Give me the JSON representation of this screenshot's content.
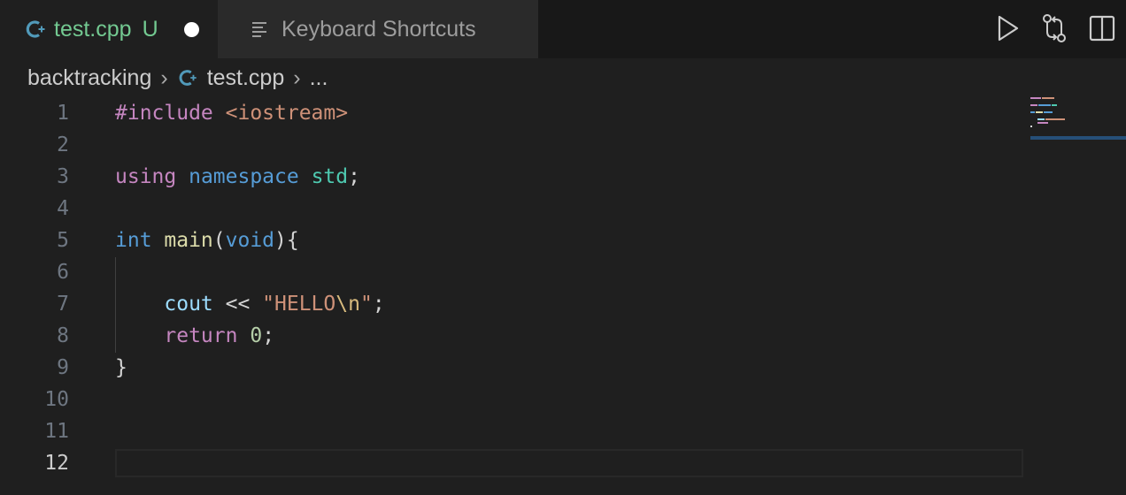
{
  "tabs": [
    {
      "label": "test.cpp",
      "status": "U",
      "icon": "cpp-icon",
      "modified": true,
      "active": true
    },
    {
      "label": "Keyboard Shortcuts",
      "icon": "list-icon",
      "active": false
    }
  ],
  "actions": [
    {
      "name": "run-button",
      "icon": "play-icon"
    },
    {
      "name": "compare-changes-button",
      "icon": "git-compare-icon"
    },
    {
      "name": "split-editor-button",
      "icon": "split-editor-icon"
    }
  ],
  "breadcrumb": {
    "folder": "backtracking",
    "file": "test.cpp",
    "more": "..."
  },
  "editor": {
    "current_line": 12,
    "lines": [
      {
        "num": "1",
        "tokens": [
          [
            "pre",
            "#include "
          ],
          [
            "inc",
            "<iostream>"
          ]
        ]
      },
      {
        "num": "2",
        "tokens": []
      },
      {
        "num": "3",
        "tokens": [
          [
            "kw",
            "using "
          ],
          [
            "type",
            "namespace "
          ],
          [
            "ns",
            "std"
          ],
          [
            "punc",
            ";"
          ]
        ]
      },
      {
        "num": "4",
        "tokens": []
      },
      {
        "num": "5",
        "tokens": [
          [
            "type",
            "int "
          ],
          [
            "fn",
            "main"
          ],
          [
            "punc",
            "("
          ],
          [
            "type",
            "void"
          ],
          [
            "punc",
            "){"
          ]
        ]
      },
      {
        "num": "6",
        "tokens": []
      },
      {
        "num": "7",
        "tokens": [
          [
            "punc",
            "    "
          ],
          [
            "var",
            "cout"
          ],
          [
            "punc",
            " << "
          ],
          [
            "str",
            "\"HELLO"
          ],
          [
            "esc",
            "\\n"
          ],
          [
            "str",
            "\""
          ],
          [
            "punc",
            ";"
          ]
        ]
      },
      {
        "num": "8",
        "tokens": [
          [
            "punc",
            "    "
          ],
          [
            "kw",
            "return "
          ],
          [
            "num",
            "0"
          ],
          [
            "punc",
            ";"
          ]
        ]
      },
      {
        "num": "9",
        "tokens": [
          [
            "punc",
            "}"
          ]
        ]
      },
      {
        "num": "10",
        "tokens": []
      },
      {
        "num": "11",
        "tokens": []
      },
      {
        "num": "12",
        "tokens": []
      }
    ]
  },
  "colors": {
    "editor_bg": "#1f1f1f",
    "modified_text": "#73c991",
    "keyword": "#c586c0",
    "type": "#569cd6",
    "string": "#ce9178"
  }
}
